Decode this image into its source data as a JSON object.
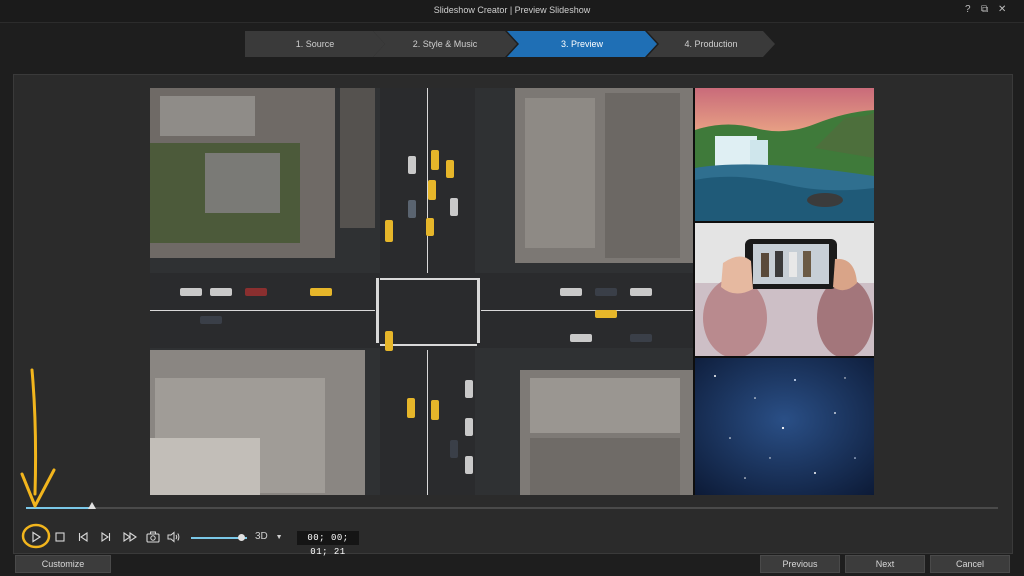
{
  "window": {
    "title": "Slideshow Creator | Preview Slideshow",
    "help_glyph": "?",
    "restore_glyph": "⧉",
    "close_glyph": "✕"
  },
  "steps": [
    {
      "label": "1. Source",
      "active": false
    },
    {
      "label": "2. Style & Music",
      "active": false
    },
    {
      "label": "3. Preview",
      "active": true
    },
    {
      "label": "4. Production",
      "active": false
    }
  ],
  "preview": {
    "tiles": [
      "waterfall-landscape",
      "phone-group-photo",
      "starry-night-sky"
    ]
  },
  "playback": {
    "progress_fraction": 0.068,
    "volume_fraction": 0.9,
    "mode_label": "3D",
    "mode_caret": "▼",
    "timecode": "00; 00; 01; 21"
  },
  "icons": [
    "play-icon",
    "stop-icon",
    "previous-frame-icon",
    "next-frame-icon",
    "fast-forward-icon",
    "snapshot-icon",
    "volume-icon"
  ],
  "colors": {
    "accent": "#1f6fb5",
    "scrub": "#7bc8e8",
    "annotation": "#f2b51d"
  },
  "buttons": {
    "customize": "Customize",
    "previous": "Previous",
    "next": "Next",
    "cancel": "Cancel"
  }
}
